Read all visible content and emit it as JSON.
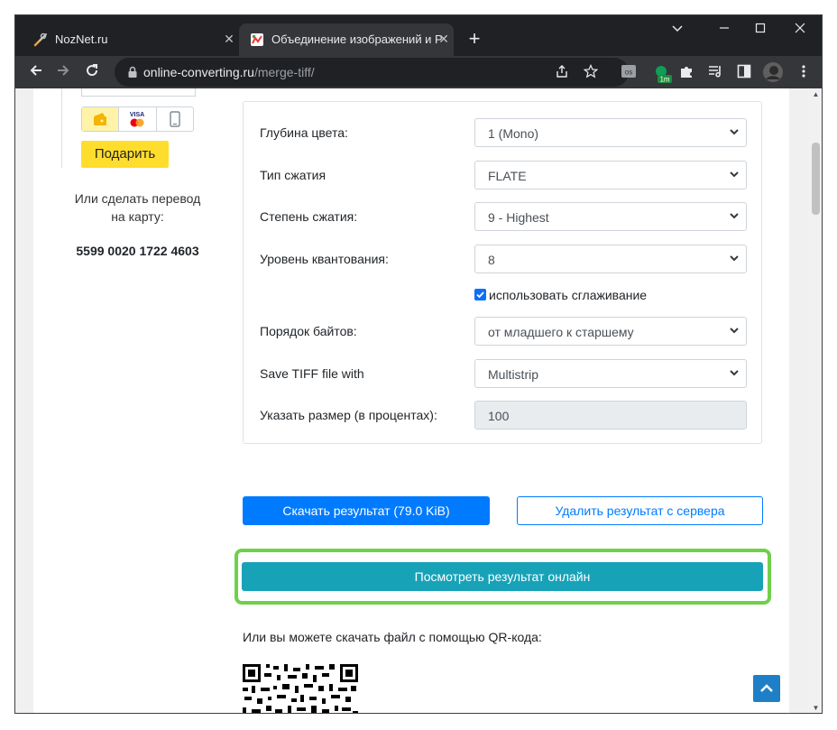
{
  "browser": {
    "tabs": [
      {
        "title": "NozNet.ru",
        "favicon": "tools-icon",
        "active": false
      },
      {
        "title": "Объединение изображений и Р",
        "favicon": "site-logo-icon",
        "active": true
      }
    ],
    "url_host": "online-converting.ru",
    "url_path": "/merge-tiff/",
    "extension_badge": "1m"
  },
  "sidebar": {
    "gift_button": "Подарить",
    "transfer_text": "Или сделать перевод на карту:",
    "card_number": "5599 0020 1722 4603",
    "payment_options": [
      "yoomoney-icon",
      "visa-mastercard-icon",
      "phone-icon"
    ],
    "visa_label": "VISA"
  },
  "form": {
    "rows": [
      {
        "label": "Глубина цвета:",
        "value": "1 (Mono)",
        "kind": "select"
      },
      {
        "label": "Тип сжатия",
        "value": "FLATE",
        "kind": "select"
      },
      {
        "label": "Степень сжатия:",
        "value": "9 - Highest",
        "kind": "select"
      },
      {
        "label": "Уровень квантования:",
        "value": "8",
        "kind": "select"
      },
      {
        "label": "Порядок байтов:",
        "value": "от младшего к старшему",
        "kind": "select"
      },
      {
        "label": "Save TIFF file with",
        "value": "Multistrip",
        "kind": "select"
      },
      {
        "label": "Указать размер (в процентах):",
        "value": "100",
        "kind": "input"
      }
    ],
    "smoothing_label": "использовать сглаживание",
    "smoothing_checked": true
  },
  "actions": {
    "download": "Скачать результат (79.0 KiB)",
    "delete": "Удалить результат с сервера",
    "view_online": "Посмотреть результат онлайн",
    "qr_text": "Или вы можете скачать файл с помощью QR-кода:"
  },
  "colors": {
    "primary": "#007bff",
    "info": "#17a2b8",
    "highlight": "#6fd04a",
    "gift": "#ffdd2d"
  }
}
